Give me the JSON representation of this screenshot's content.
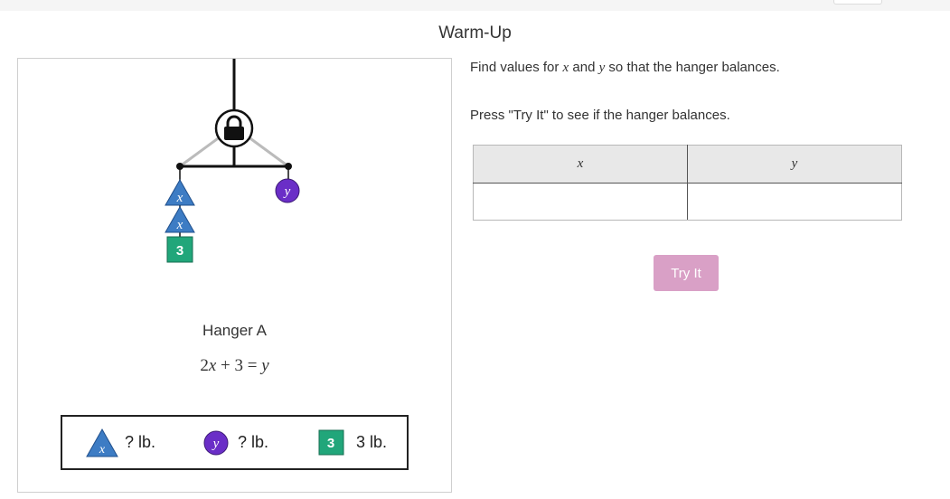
{
  "header": {
    "title": "Warm-Up"
  },
  "instructions": {
    "line1_prefix": "Find values for ",
    "line1_x": "x",
    "line1_mid": " and ",
    "line1_y": "y",
    "line1_suffix": " so that the hanger balances.",
    "line2": "Press \"Try It\" to see if the hanger balances."
  },
  "table": {
    "columns": [
      "x",
      "y"
    ],
    "row": [
      "",
      ""
    ]
  },
  "try_button": {
    "label": "Try It"
  },
  "hanger": {
    "name": "Hanger A",
    "equation": {
      "a": "2",
      "x": "x",
      "op1": " + 3 = ",
      "y": "y"
    },
    "left_items": [
      {
        "type": "triangle",
        "label": "x"
      },
      {
        "type": "triangle",
        "label": "x"
      },
      {
        "type": "square",
        "label": "3"
      }
    ],
    "right_items": [
      {
        "type": "circle",
        "label": "y"
      }
    ],
    "lock_icon": "lock-icon"
  },
  "legend": [
    {
      "shape": "triangle",
      "symbol": "x",
      "weight": "? lb."
    },
    {
      "shape": "circle",
      "symbol": "y",
      "weight": "? lb."
    },
    {
      "shape": "square",
      "symbol": "3",
      "weight": "3 lb."
    }
  ],
  "colors": {
    "triangle_fill": "#3d7cc4",
    "circle_fill": "#6a2ec7",
    "square_fill": "#21a67a",
    "button_fill": "#d9a0c6"
  }
}
